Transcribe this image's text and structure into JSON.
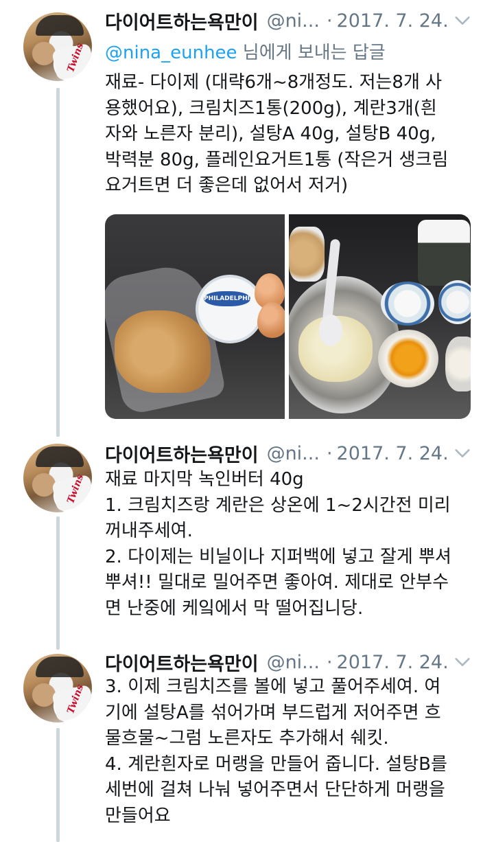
{
  "colors": {
    "text": "#14171a",
    "muted": "#657786",
    "link": "#1da1f2",
    "thread": "#ccd6dd"
  },
  "tweets": [
    {
      "name": "다이어트하는욕만이",
      "handle": "@ni...",
      "separator": "·",
      "date": "2017. 7. 24.",
      "replying_mention": "@nina_eunhee",
      "replying_suffix": " 님에게 보내는 답글",
      "lines": [
        "재료- 다이제 (대략6개~8개정도. 저는8개 사",
        "용했어요), 크림치즈1통(200g), 계란3개(흰",
        "자와 노른자 분리), 설탕A 40g, 설탕B 40g,",
        "박력분 80g, 플레인요거트1통 (작은거 생크림",
        "요거트면 더 좋은데 없어서 저거)"
      ],
      "photo_labels": {
        "left_tub": "PHILADELPHIA"
      }
    },
    {
      "name": "다이어트하는욕만이",
      "handle": "@ni...",
      "separator": "·",
      "date": "2017. 7. 24.",
      "lines": [
        "재료 마지막 녹인버터 40g",
        "1. 크림치즈랑 계란은 상온에 1~2시간전 미리",
        "꺼내주세여.",
        "2. 다이제는 비닐이나 지퍼백에 넣고 잘게 뿌셔",
        "뿌셔!! 밀대로 밀어주면 좋아여. 제대로 안부수",
        "면 난중에 케잌에서 막 떨어집니당."
      ]
    },
    {
      "name": "다이어트하는욕만이",
      "handle": "@ni...",
      "separator": "·",
      "date": "2017. 7. 24.",
      "lines": [
        "3. 이제 크림치즈를 볼에 넣고 풀어주세여. 여",
        "기에 설탕A를 섞어가며 부드럽게 저어주면 흐",
        "물흐물~그럼 노른자도 추가해서 쉐킷.",
        "4. 계란흰자로 머랭을 만들어 줍니다. 설탕B를",
        "세번에 걸쳐 나눠 넣어주면서 단단하게 머랭을",
        "만들어요"
      ]
    }
  ],
  "avatar_logo": "Twins",
  "icons": {
    "chevron": "chevron-down-icon"
  }
}
